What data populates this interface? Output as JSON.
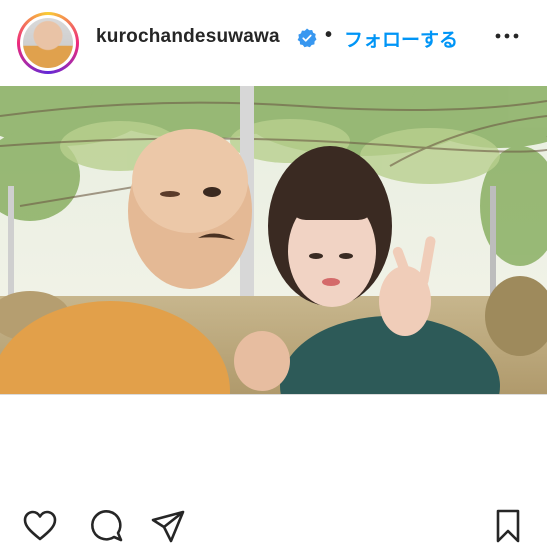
{
  "post": {
    "username": "kurochandesuwawa",
    "separator": "•",
    "follow_label": "フォローする",
    "verified": true,
    "accent_color": "#0095f6"
  },
  "photo": {
    "description_hidden": true
  },
  "actions": {
    "icons": [
      "heart-icon",
      "comment-icon",
      "share-icon",
      "bookmark-icon"
    ]
  }
}
